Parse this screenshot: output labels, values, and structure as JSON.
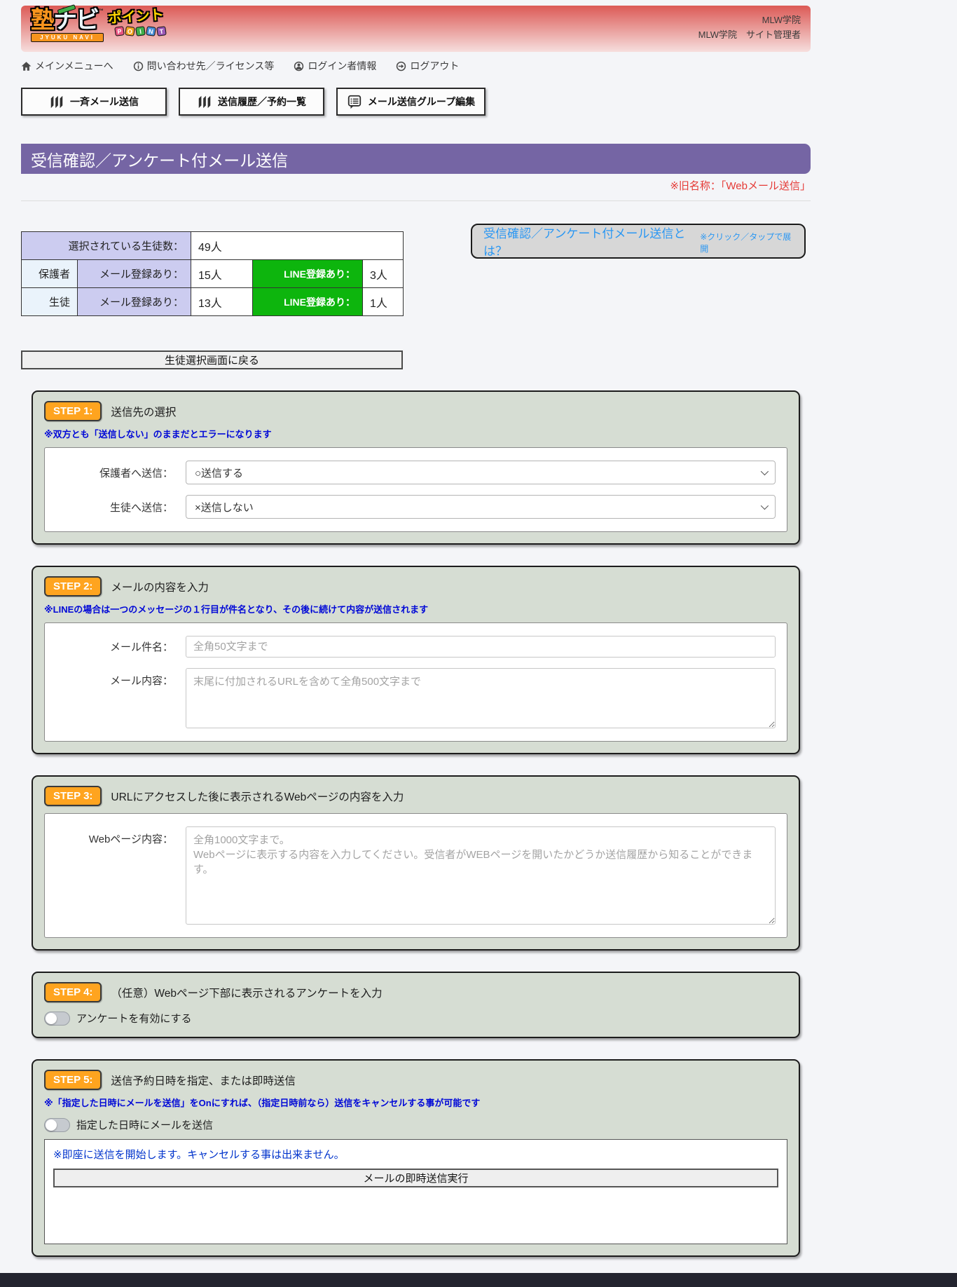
{
  "header": {
    "logo": {
      "kanji": "塾",
      "kana": "ナビ",
      "tm": "™",
      "bar": "JYUKU NAVI",
      "point": "ポイント",
      "tiles": [
        "P",
        "O",
        "I",
        "N",
        "T"
      ]
    },
    "school_name": "MLW学院",
    "user_line": "MLW学院　サイト管理者"
  },
  "nav": {
    "items": [
      {
        "icon": "home-icon",
        "label": "メインメニューへ"
      },
      {
        "icon": "info-icon",
        "label": "問い合わせ先／ライセンス等"
      },
      {
        "icon": "user-icon",
        "label": "ログイン者情報"
      },
      {
        "icon": "logout-icon",
        "label": "ログアウト"
      }
    ]
  },
  "toolbar": {
    "buttons": [
      {
        "icon": "books-icon",
        "label": "一斉メール送信"
      },
      {
        "icon": "books-icon",
        "label": "送信履歴／予約一覧"
      },
      {
        "icon": "memo-icon",
        "label": "メール送信グループ編集"
      }
    ]
  },
  "page": {
    "title": "受信確認／アンケート付メール送信",
    "old_name_note": "※旧名称：「Webメール送信」"
  },
  "summary_table": {
    "selected_label": "選択されている生徒数：",
    "selected_value": "49人",
    "rows": [
      {
        "group": "保護者",
        "mail_label": "メール登録あり：",
        "mail_value": "15人",
        "line_label": "LINE登録あり：",
        "line_value": "3人"
      },
      {
        "group": "生徒",
        "mail_label": "メール登録あり：",
        "mail_value": "13人",
        "line_label": "LINE登録あり：",
        "line_value": "1人"
      }
    ]
  },
  "help_panel": {
    "title": "受信確認／アンケート付メール送信とは？",
    "hint": "※クリック／タップで展開"
  },
  "back_button": {
    "label": "生徒選択画面に戻る"
  },
  "steps": {
    "step1": {
      "badge": "STEP 1:",
      "title": "送信先の選択",
      "note": "※双方とも「送信しない」のままだとエラーになります",
      "fields": [
        {
          "label": "保護者へ送信：",
          "value": "○送信する"
        },
        {
          "label": "生徒へ送信：",
          "value": "×送信しない"
        }
      ]
    },
    "step2": {
      "badge": "STEP 2:",
      "title": "メールの内容を入力",
      "note": "※LINEの場合は一つのメッセージの１行目が件名となり、その後に続けて内容が送信されます",
      "subject_label": "メール件名：",
      "subject_placeholder": "全角50文字まで",
      "body_label": "メール内容：",
      "body_placeholder": "末尾に付加されるURLを含めて全角500文字まで"
    },
    "step3": {
      "badge": "STEP 3:",
      "title": "URLにアクセスした後に表示されるWebページの内容を入力",
      "web_label": "Webページ内容：",
      "web_placeholder": "全角1000文字まで。\nWebページに表示する内容を入力してください。受信者がWEBページを開いたかどうか送信履歴から知ることができます。"
    },
    "step4": {
      "badge": "STEP 4:",
      "title": "（任意）Webページ下部に表示されるアンケートを入力",
      "toggle_label": "アンケートを有効にする",
      "toggle_state": "off"
    },
    "step5": {
      "badge": "STEP 5:",
      "title": "送信予約日時を指定、または即時送信",
      "note": "※「指定した日時にメールを送信」をOnにすれば、（指定日時前なら）送信をキャンセルする事が可能です",
      "toggle_label": "指定した日時にメールを送信",
      "toggle_state": "off",
      "immediate_note": "※即座に送信を開始します。キャンセルする事は出来ません。",
      "send_button": "メールの即時送信実行"
    }
  },
  "colors": {
    "header_gradient_top": "#dc5a56",
    "title_bar_purple": "#7565a4",
    "old_name_red": "#e53935",
    "table_lavender": "#ccccf0",
    "table_light_blue": "#eaf3fb",
    "line_green": "#0db50d",
    "step_background": "#d6ddd3",
    "badge_orange": "#ffa41f",
    "note_blue": "#0008d7",
    "help_link_blue": "#2a97f3",
    "footer_dark": "#23242f"
  }
}
